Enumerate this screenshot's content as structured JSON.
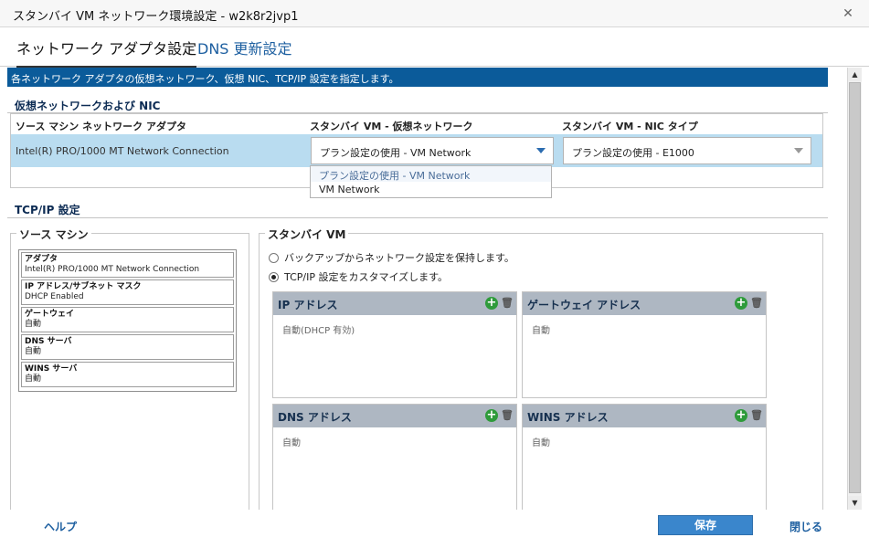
{
  "window": {
    "title": "スタンバイ VM ネットワーク環境設定 - w2k8r2jvp1"
  },
  "tabs": [
    {
      "label": "ネットワーク アダプタ設定"
    },
    {
      "label": "DNS 更新設定"
    }
  ],
  "banner": "各ネットワーク アダプタの仮想ネットワーク、仮想 NIC、TCP/IP 設定を指定します。",
  "nic_section": {
    "title": "仮想ネットワークおよび NIC",
    "headers": [
      "ソース マシン ネットワーク アダプタ",
      "スタンバイ VM - 仮想ネットワーク",
      "スタンバイ VM - NIC タイプ"
    ],
    "row": {
      "adapter": "Intel(R) PRO/1000 MT Network Connection",
      "network_value": "プラン設定の使用 - VM Network",
      "nic_type_value": "プラン設定の使用 - E1000"
    },
    "network_options": [
      "プラン設定の使用 - VM Network",
      "VM Network"
    ]
  },
  "tcpip_section": {
    "title": "TCP/IP 設定",
    "source": {
      "legend": "ソース マシン",
      "items": [
        {
          "key": "アダプタ",
          "value": "Intel(R) PRO/1000 MT Network Connection"
        },
        {
          "key": "IP アドレス/サブネット マスク",
          "value": "DHCP Enabled"
        },
        {
          "key": "ゲートウェイ",
          "value": "自動"
        },
        {
          "key": "DNS サーバ",
          "value": "自動"
        },
        {
          "key": "WINS サーバ",
          "value": "自動"
        }
      ]
    },
    "standby": {
      "legend": "スタンバイ VM",
      "radio_keep": "バックアップからネットワーク設定を保持します。",
      "radio_customize": "TCP/IP 設定をカスタマイズします。",
      "panels": [
        {
          "title": "IP アドレス",
          "body": "自動(DHCP 有効)"
        },
        {
          "title": "ゲートウェイ アドレス",
          "body": "自動"
        },
        {
          "title": "DNS アドレス",
          "body": "自動"
        },
        {
          "title": "WINS アドレス",
          "body": "自動"
        }
      ]
    }
  },
  "footer": {
    "help": "ヘルプ",
    "save": "保存",
    "close": "閉じる"
  },
  "icons": {
    "close": "close-icon",
    "add": "add-icon",
    "delete": "trash-icon"
  },
  "colors": {
    "banner": "#0b5b9a",
    "selected_row": "#b9dcf0",
    "save_button": "#3a86cc",
    "link": "#1d5fa0"
  }
}
